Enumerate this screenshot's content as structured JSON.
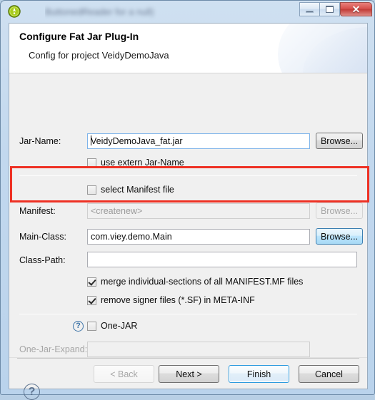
{
  "window": {
    "icon_name": "fatjar-app-icon",
    "obscured_title": "ButtonedReader for a null)",
    "buttons": {
      "minimize": "minimize-icon",
      "maximize": "maximize-icon",
      "close": "✕"
    }
  },
  "header": {
    "title": "Configure Fat Jar Plug-In",
    "subtitle": "Config for project VeidyDemoJava"
  },
  "form": {
    "jar_name": {
      "label": "Jar-Name:",
      "value": "VeidyDemoJava_fat.jar",
      "browse_label": "Browse..."
    },
    "use_extern": {
      "label": "use extern Jar-Name",
      "checked": false
    },
    "select_manifest": {
      "label": "select Manifest file",
      "checked": false
    },
    "manifest": {
      "label": "Manifest:",
      "value": "<createnew>",
      "browse_label": "Browse...",
      "disabled": true
    },
    "main_class": {
      "label": "Main-Class:",
      "value": "com.viey.demo.Main",
      "browse_label": "Browse..."
    },
    "class_path": {
      "label": "Class-Path:",
      "value": ""
    },
    "merge_sections": {
      "label": "merge individual-sections of all MANIFEST.MF files",
      "checked": true
    },
    "remove_signer": {
      "label": "remove signer files (*.SF) in META-INF",
      "checked": true
    },
    "one_jar": {
      "label": "One-JAR",
      "checked": false,
      "help_icon": "?"
    },
    "one_jar_expand": {
      "label": "One-Jar-Expand:",
      "value": "",
      "disabled": true
    }
  },
  "footer": {
    "help_icon": "?",
    "back_label": "< Back",
    "next_label": "Next >",
    "finish_label": "Finish",
    "cancel_label": "Cancel"
  },
  "annotation": {
    "highlight_color": "#ee3124",
    "target": "Main-Class row"
  }
}
